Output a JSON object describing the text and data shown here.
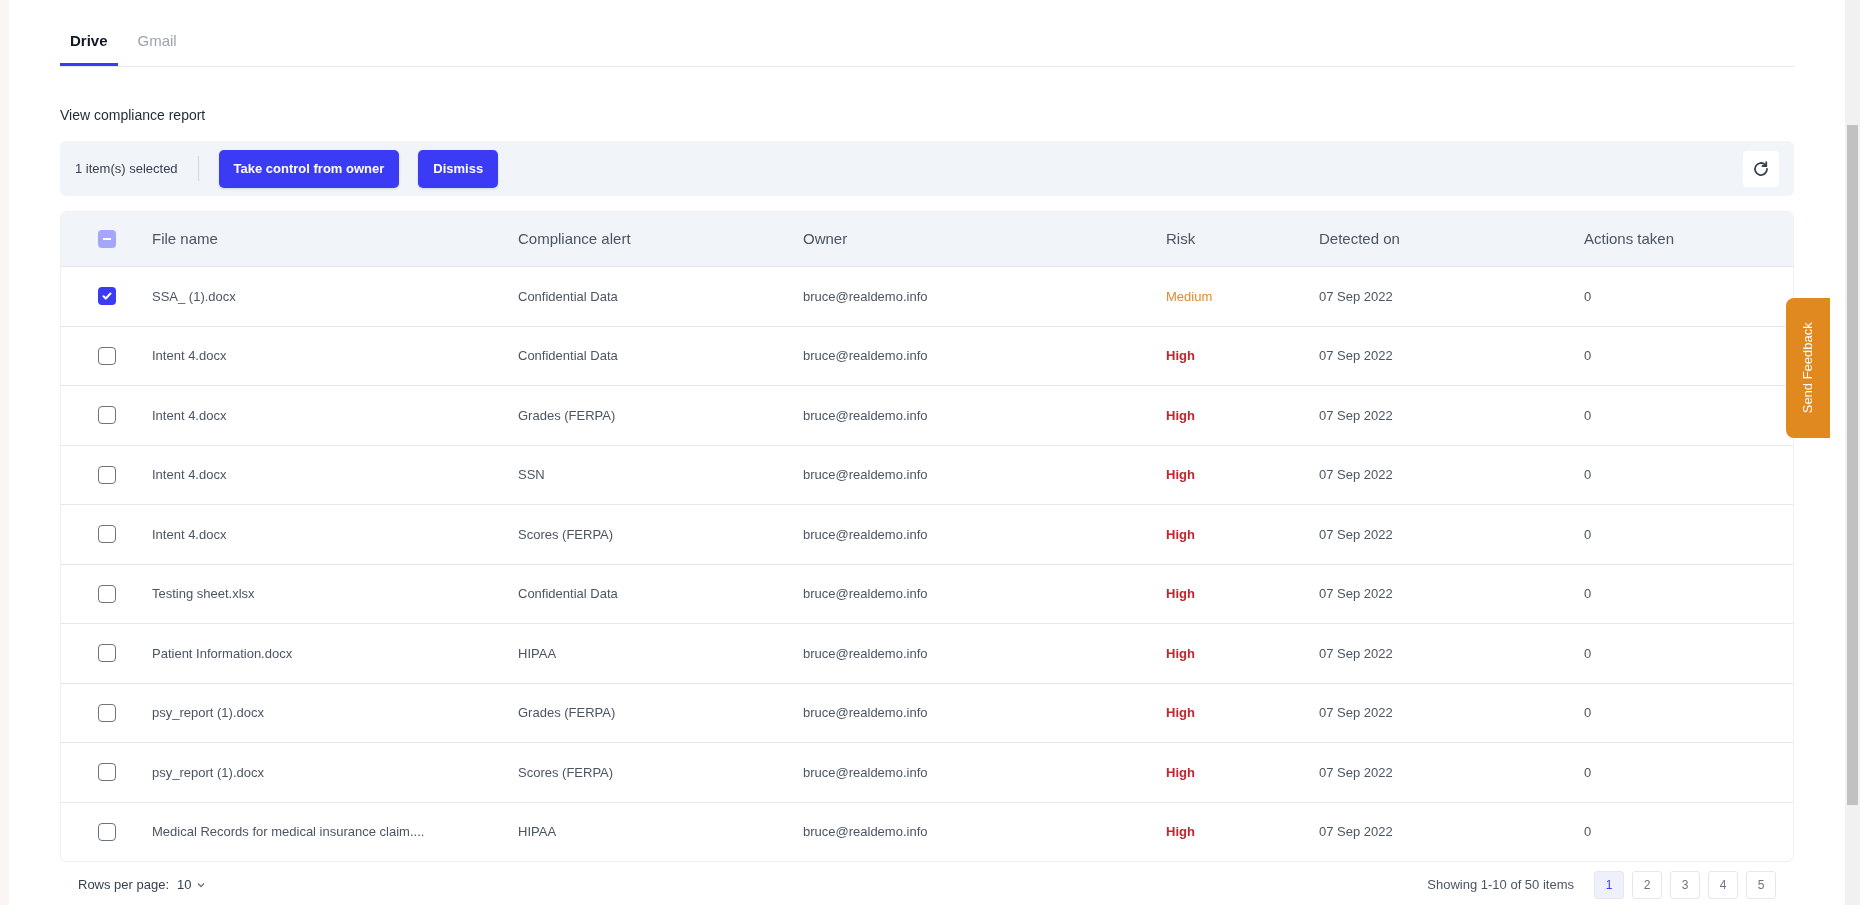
{
  "tabs": [
    {
      "label": "Drive",
      "selected": true
    },
    {
      "label": "Gmail",
      "selected": false
    }
  ],
  "report_link": "View compliance report",
  "toolbar": {
    "selection_count": "1 item(s) selected",
    "buttons": [
      "Take control from owner",
      "Dismiss"
    ]
  },
  "table": {
    "header_checkbox": {
      "indeterminate": true
    },
    "columns": [
      "File name",
      "Compliance alert",
      "Owner",
      "Risk",
      "Detected on",
      "Actions taken"
    ],
    "rows": [
      {
        "selected": true,
        "file_name": "SSA_ (1).docx",
        "alert": "Confidential Data",
        "owner": "bruce@realdemo.info",
        "risk": {
          "text": "Medium",
          "kind": "medium"
        },
        "detected_on": "07 Sep 2022",
        "actions_taken": "0"
      },
      {
        "selected": false,
        "file_name": "Intent 4.docx",
        "alert": "Confidential Data",
        "owner": "bruce@realdemo.info",
        "risk": {
          "text": "High",
          "kind": "high"
        },
        "detected_on": "07 Sep 2022",
        "actions_taken": "0"
      },
      {
        "selected": false,
        "file_name": "Intent 4.docx",
        "alert": "Grades (FERPA)",
        "owner": "bruce@realdemo.info",
        "risk": {
          "text": "High",
          "kind": "high"
        },
        "detected_on": "07 Sep 2022",
        "actions_taken": "0"
      },
      {
        "selected": false,
        "file_name": "Intent 4.docx",
        "alert": "SSN",
        "owner": "bruce@realdemo.info",
        "risk": {
          "text": "High",
          "kind": "high"
        },
        "detected_on": "07 Sep 2022",
        "actions_taken": "0"
      },
      {
        "selected": false,
        "file_name": "Intent 4.docx",
        "alert": "Scores (FERPA)",
        "owner": "bruce@realdemo.info",
        "risk": {
          "text": "High",
          "kind": "high"
        },
        "detected_on": "07 Sep 2022",
        "actions_taken": "0"
      },
      {
        "selected": false,
        "file_name": "Testing sheet.xlsx",
        "alert": "Confidential Data",
        "owner": "bruce@realdemo.info",
        "risk": {
          "text": "High",
          "kind": "high"
        },
        "detected_on": "07 Sep 2022",
        "actions_taken": "0"
      },
      {
        "selected": false,
        "file_name": "Patient Information.docx",
        "alert": "HIPAA",
        "owner": "bruce@realdemo.info",
        "risk": {
          "text": "High",
          "kind": "high"
        },
        "detected_on": "07 Sep 2022",
        "actions_taken": "0"
      },
      {
        "selected": false,
        "file_name": "psy_report (1).docx",
        "alert": "Grades (FERPA)",
        "owner": "bruce@realdemo.info",
        "risk": {
          "text": "High",
          "kind": "high"
        },
        "detected_on": "07 Sep 2022",
        "actions_taken": "0"
      },
      {
        "selected": false,
        "file_name": "psy_report (1).docx",
        "alert": "Scores (FERPA)",
        "owner": "bruce@realdemo.info",
        "risk": {
          "text": "High",
          "kind": "high"
        },
        "detected_on": "07 Sep 2022",
        "actions_taken": "0"
      },
      {
        "selected": false,
        "file_name": "Medical Records for medical insurance claim....",
        "alert": "HIPAA",
        "owner": "bruce@realdemo.info",
        "risk": {
          "text": "High",
          "kind": "high"
        },
        "detected_on": "07 Sep 2022",
        "actions_taken": "0"
      }
    ]
  },
  "footer": {
    "rows_per_page_label": "Rows per page:",
    "rows_per_page_value": "10",
    "summary": "Showing 1-10 of 50 items",
    "pages": [
      {
        "label": "1",
        "selected": true
      },
      {
        "label": "2",
        "selected": false
      },
      {
        "label": "3",
        "selected": false
      },
      {
        "label": "4",
        "selected": false
      },
      {
        "label": "5",
        "selected": false
      }
    ]
  },
  "feedback_tab": "Send Feedback"
}
